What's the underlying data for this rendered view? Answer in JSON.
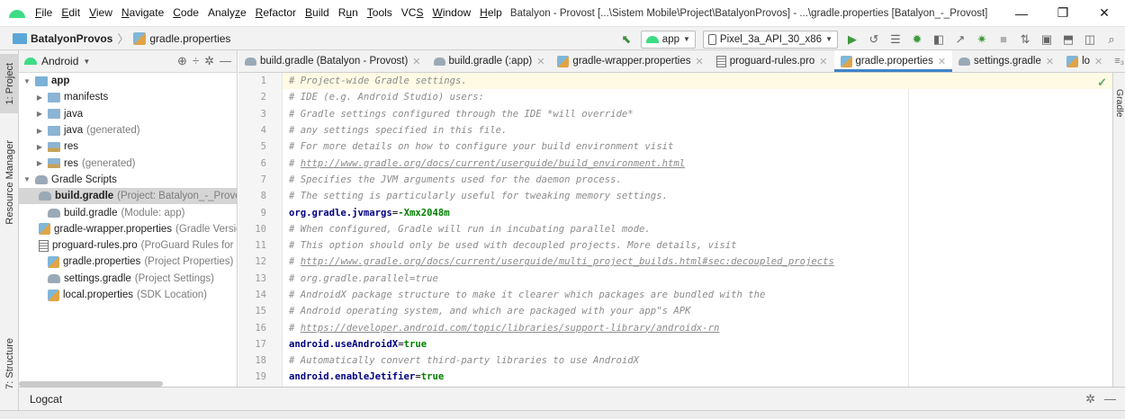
{
  "menu": {
    "items": [
      {
        "label": "File",
        "mnemonic": "F",
        "rest": "ile"
      },
      {
        "label": "Edit",
        "mnemonic": "E",
        "rest": "dit"
      },
      {
        "label": "View",
        "mnemonic": "V",
        "rest": "iew"
      },
      {
        "label": "Navigate",
        "mnemonic": "N",
        "rest": "avigate"
      },
      {
        "label": "Code",
        "mnemonic": "C",
        "rest": "ode"
      },
      {
        "label": "Analyze",
        "pre": "Analy",
        "mnemonic": "z",
        "rest": "e"
      },
      {
        "label": "Refactor",
        "mnemonic": "R",
        "rest": "efactor"
      },
      {
        "label": "Build",
        "mnemonic": "B",
        "rest": "uild"
      },
      {
        "label": "Run",
        "pre": "R",
        "mnemonic": "u",
        "rest": "n"
      },
      {
        "label": "Tools",
        "mnemonic": "T",
        "rest": "ools"
      },
      {
        "label": "VCS",
        "pre": "VC",
        "mnemonic": "S",
        "rest": ""
      },
      {
        "label": "Window",
        "mnemonic": "W",
        "rest": "indow"
      },
      {
        "label": "Help",
        "mnemonic": "H",
        "rest": "elp"
      }
    ],
    "window_title": "Batalyon - Provost [...\\Sistem Mobile\\Project\\BatalyonProvos] - ...\\gradle.properties [Batalyon_-_Provost]"
  },
  "window_controls": {
    "minimize": "—",
    "maximize": "❐",
    "close": "✕"
  },
  "breadcrumb": {
    "project": "BatalyonProvos",
    "separator": "〉",
    "file": "gradle.properties"
  },
  "toolbar": {
    "config": "app",
    "device": "Pixel_3a_API_30_x86",
    "icons": [
      "hammer-icon",
      "run-icon",
      "debug-icon",
      "profile-icon",
      "attach-icon",
      "apply-changes-icon",
      "apply-code-icon",
      "stop-icon",
      "sync-icon",
      "avd-icon",
      "sdk-icon",
      "layout-inspector-icon",
      "search-icon"
    ]
  },
  "side_tabs": {
    "project": "1: Project",
    "resource_manager": "Resource Manager",
    "structure": "7: Structure",
    "right": "Gradle"
  },
  "project_panel": {
    "view_mode": "Android",
    "tree": [
      {
        "indent": 0,
        "arrow": "▼",
        "icon": "folder-app",
        "name": "app",
        "hint": "",
        "bold": true,
        "selected": false
      },
      {
        "indent": 1,
        "arrow": "▶",
        "icon": "folder",
        "name": "manifests",
        "hint": "",
        "bold": false,
        "selected": false
      },
      {
        "indent": 1,
        "arrow": "▶",
        "icon": "folder",
        "name": "java",
        "hint": "",
        "bold": false,
        "selected": false
      },
      {
        "indent": 1,
        "arrow": "▶",
        "icon": "folder",
        "name": "java",
        "hint": "(generated)",
        "bold": false,
        "selected": false
      },
      {
        "indent": 1,
        "arrow": "▶",
        "icon": "folder-res",
        "name": "res",
        "hint": "",
        "bold": false,
        "selected": false
      },
      {
        "indent": 1,
        "arrow": "▶",
        "icon": "folder-res",
        "name": "res",
        "hint": "(generated)",
        "bold": false,
        "selected": false
      },
      {
        "indent": 0,
        "arrow": "▼",
        "icon": "gradle",
        "name": "Gradle Scripts",
        "hint": "",
        "bold": false,
        "selected": false
      },
      {
        "indent": 1,
        "arrow": "",
        "icon": "gradle",
        "name": "build.gradle",
        "hint": "(Project: Batalyon_-_Provost)",
        "bold": true,
        "selected": true
      },
      {
        "indent": 1,
        "arrow": "",
        "icon": "gradle",
        "name": "build.gradle",
        "hint": "(Module: app)",
        "bold": false,
        "selected": false
      },
      {
        "indent": 1,
        "arrow": "",
        "icon": "props",
        "name": "gradle-wrapper.properties",
        "hint": "(Gradle Version)",
        "bold": false,
        "selected": false
      },
      {
        "indent": 1,
        "arrow": "",
        "icon": "txt",
        "name": "proguard-rules.pro",
        "hint": "(ProGuard Rules for app)",
        "bold": false,
        "selected": false
      },
      {
        "indent": 1,
        "arrow": "",
        "icon": "props",
        "name": "gradle.properties",
        "hint": "(Project Properties)",
        "bold": false,
        "selected": false
      },
      {
        "indent": 1,
        "arrow": "",
        "icon": "gradle",
        "name": "settings.gradle",
        "hint": "(Project Settings)",
        "bold": false,
        "selected": false
      },
      {
        "indent": 1,
        "arrow": "",
        "icon": "props",
        "name": "local.properties",
        "hint": "(SDK Location)",
        "bold": false,
        "selected": false
      }
    ]
  },
  "editor_tabs": [
    {
      "label": "build.gradle (Batalyon - Provost)",
      "icon": "gradle",
      "active": false
    },
    {
      "label": "build.gradle (:app)",
      "icon": "gradle",
      "active": false
    },
    {
      "label": "gradle-wrapper.properties",
      "icon": "props",
      "active": false
    },
    {
      "label": "proguard-rules.pro",
      "icon": "txt",
      "active": false
    },
    {
      "label": "gradle.properties",
      "icon": "props",
      "active": true
    },
    {
      "label": "settings.gradle",
      "icon": "gradle",
      "active": false
    },
    {
      "label": "lo",
      "icon": "props",
      "active": false
    }
  ],
  "editor_tab_overflow": "≡₃",
  "code_lines": [
    {
      "n": "1",
      "type": "comment",
      "text": "# Project-wide Gradle settings."
    },
    {
      "n": "2",
      "type": "comment",
      "text": "# IDE (e.g. Android Studio) users:"
    },
    {
      "n": "3",
      "type": "comment",
      "text": "# Gradle settings configured through the IDE *will override*"
    },
    {
      "n": "4",
      "type": "comment",
      "text": "# any settings specified in this file."
    },
    {
      "n": "5",
      "type": "comment",
      "text": "# For more details on how to configure your build environment visit"
    },
    {
      "n": "6",
      "type": "link",
      "prefix": "# ",
      "text": "http://www.gradle.org/docs/current/userguide/build_environment.html"
    },
    {
      "n": "7",
      "type": "comment",
      "text": "# Specifies the JVM arguments used for the daemon process."
    },
    {
      "n": "8",
      "type": "comment",
      "text": "# The setting is particularly useful for tweaking memory settings."
    },
    {
      "n": "9",
      "type": "prop",
      "key": "org.gradle.jvmargs",
      "value": "-Xmx2048m"
    },
    {
      "n": "10",
      "type": "comment",
      "text": "# When configured, Gradle will run in incubating parallel mode."
    },
    {
      "n": "11",
      "type": "comment",
      "text": "# This option should only be used with decoupled projects. More details, visit"
    },
    {
      "n": "12",
      "type": "link",
      "prefix": "# ",
      "text": "http://www.gradle.org/docs/current/userguide/multi_project_builds.html#sec:decoupled_projects"
    },
    {
      "n": "13",
      "type": "comment",
      "text": "# org.gradle.parallel=true"
    },
    {
      "n": "14",
      "type": "comment",
      "text": "# AndroidX package structure to make it clearer which packages are bundled with the"
    },
    {
      "n": "15",
      "type": "comment",
      "text": "# Android operating system, and which are packaged with your app\"s APK"
    },
    {
      "n": "16",
      "type": "link",
      "prefix": "# ",
      "text": "https://developer.android.com/topic/libraries/support-library/androidx-rn"
    },
    {
      "n": "17",
      "type": "prop",
      "key": "android.useAndroidX",
      "value": "true"
    },
    {
      "n": "18",
      "type": "comment",
      "text": "# Automatically convert third-party libraries to use AndroidX"
    },
    {
      "n": "19",
      "type": "prop",
      "key": "android.enableJetifier",
      "value": "true"
    }
  ],
  "bottom_panel": {
    "title": "Logcat"
  },
  "colors": {
    "accent": "#4083c9",
    "android_green": "#3ddc84",
    "comment": "#8c8c8c",
    "key": "#000080",
    "value": "#008000"
  }
}
